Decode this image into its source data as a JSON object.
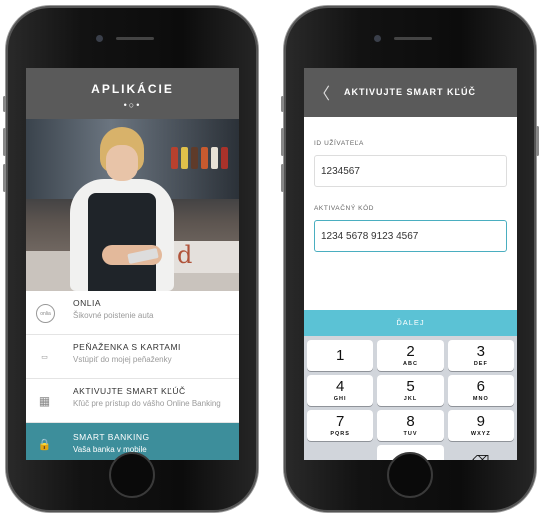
{
  "left_screen": {
    "header_title": "APLIKÁCIE",
    "pager_dots": "•○•",
    "menu": [
      {
        "icon": "onlia-logo-icon",
        "icon_text": "onlia",
        "title": "ONLIA",
        "subtitle": "Šikovné poistenie auta",
        "active": false
      },
      {
        "icon": "wallet-icon",
        "icon_text": "▭",
        "title": "PEŇAŽENKA S KARTAMI",
        "subtitle": "Vstúpiť do mojej peňaženky",
        "active": false
      },
      {
        "icon": "calculator-icon",
        "icon_text": "▦",
        "title": "AKTIVUJTE SMART KĽÚČ",
        "subtitle": "Kľúč pre prístup do vášho Online Banking",
        "active": false
      },
      {
        "icon": "lock-icon",
        "icon_text": "🔒",
        "title": "SMART BANKING",
        "subtitle": "Vaša banka v mobile",
        "active": true
      }
    ],
    "hero_sign_text": "d"
  },
  "right_screen": {
    "header_title": "AKTIVUJTE SMART KĽÚČ",
    "back_icon": "chevron-left-icon",
    "back_glyph": "〈",
    "user_id_label": "ID UŽÍVATEĽA",
    "user_id_value": "1234567",
    "activation_label": "AKTIVAČNÝ KÓD",
    "activation_value": "1234 5678 9123 4567",
    "next_button": "ĎALEJ",
    "keypad": [
      {
        "num": "1",
        "letters": ""
      },
      {
        "num": "2",
        "letters": "ABC"
      },
      {
        "num": "3",
        "letters": "DEF"
      },
      {
        "num": "4",
        "letters": "GHI"
      },
      {
        "num": "5",
        "letters": "JKL"
      },
      {
        "num": "6",
        "letters": "MNO"
      },
      {
        "num": "7",
        "letters": "PQRS"
      },
      {
        "num": "8",
        "letters": "TUV"
      },
      {
        "num": "9",
        "letters": "WXYZ"
      },
      {
        "num": "",
        "letters": ""
      },
      {
        "num": "0",
        "letters": ""
      },
      {
        "num": "⌫",
        "letters": ""
      }
    ]
  },
  "colors": {
    "header_gray": "#5a5a5a",
    "active_teal": "#3d8e9b",
    "next_button": "#5bc2d5",
    "input_focus": "#4aaec0",
    "keyboard_bg": "#d1d5db"
  }
}
